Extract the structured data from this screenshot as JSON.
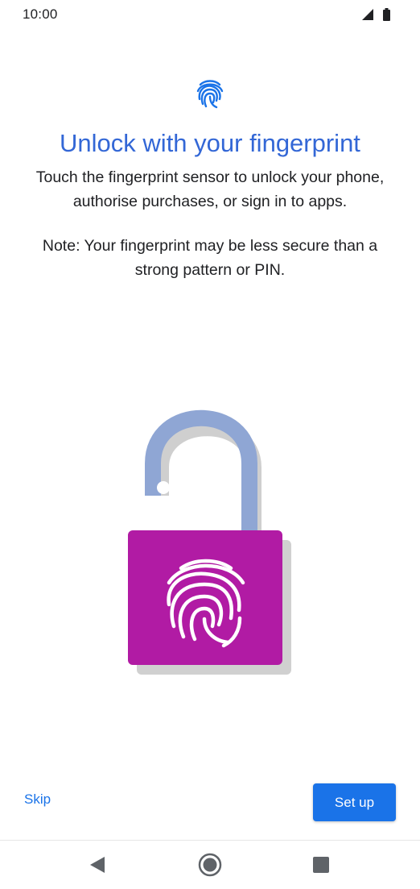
{
  "status_bar": {
    "time": "10:00"
  },
  "page": {
    "header_icon": "fingerprint-icon",
    "title": "Unlock with your fingerprint",
    "description": "Touch the fingerprint sensor to unlock your phone, authorise purchases, or sign in to apps.",
    "note": "Note: Your fingerprint may be less secure than a strong pattern or PIN."
  },
  "illustration": {
    "name": "padlock-fingerprint-illustration",
    "colors": {
      "shackle": "#8fa6d4",
      "shadow": "#d0d0d0",
      "lock_body": "#b11ba4",
      "fingerprint": "#ffffff"
    }
  },
  "actions": {
    "skip_label": "Skip",
    "setup_label": "Set up"
  },
  "navigation": {
    "back": "back-icon",
    "home": "home-icon",
    "recents": "recents-icon"
  },
  "colors": {
    "accent": "#1a73e8",
    "title": "#3367d6"
  }
}
